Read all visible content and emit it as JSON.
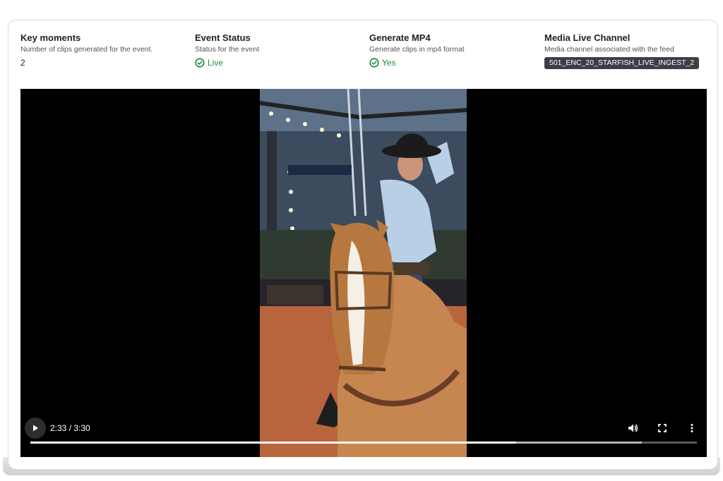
{
  "details": {
    "key_moments": {
      "title": "Key moments",
      "description": "Number of clips generated for the event.",
      "value": "2"
    },
    "event_status": {
      "title": "Event Status",
      "description": "Status for the event",
      "value": "Live",
      "icon": "check-circle-icon",
      "color": "#1d8a3e"
    },
    "generate_mp4": {
      "title": "Generate MP4",
      "description": "Generate clips in mp4 format",
      "value": "Yes",
      "icon": "check-circle-icon",
      "color": "#1d8a3e"
    },
    "media_live_channel": {
      "title": "Media Live Channel",
      "description": "Media channel associated with the feed",
      "value": "501_ENC_20_STARFISH_LIVE_INGEST_2"
    }
  },
  "player": {
    "time": "2:33 / 3:30",
    "played_fraction": 0.729,
    "buffered_fraction": 0.917,
    "icons": [
      "play-icon",
      "volume-icon",
      "fullscreen-icon",
      "more-vert-icon"
    ]
  }
}
